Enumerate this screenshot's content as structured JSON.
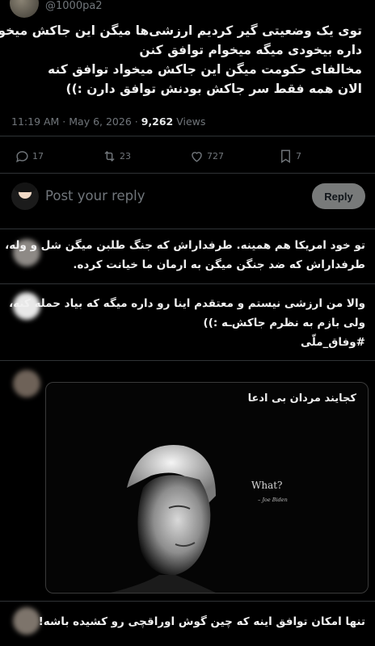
{
  "header": {
    "handle": "@1000pa2"
  },
  "tweet": {
    "lines": [
      "توی یک وضعیتی گیر کردیم ارزشی‌ها میگن این جاکش میخواد حمله کنه",
      "داره بیخودی میگه میخوام توافق کنن",
      "مخالفای حکومت میگن این جاکش میخواد توافق کنه",
      "الان همه فقط سر جاکش بودنش توافق دارن :))"
    ],
    "time": "11:19 AM · May 6, 2026 · ",
    "views_count": "9,262",
    "views_label": " Views"
  },
  "actions": {
    "replies": "17",
    "retweets": "23",
    "likes": "727",
    "bookmarks": "7"
  },
  "composer": {
    "placeholder": "Post your reply",
    "button": "Reply"
  },
  "replies": [
    {
      "lines": [
        "تو خود امریکا هم همینه. طرفداراش که جنگ طلبن میگن شل و وله،",
        "طرفداراش که ضد جنگن میگن به ارمان ما خیانت کرده."
      ]
    },
    {
      "lines": [
        "والا من ارزشی نیستم و معتقدم اینا رو داره میگه که بیاد حمله کنه،",
        "ولی بازم به نظرم جاکش‌ـه :))",
        "#وفاق_ملّی"
      ]
    },
    {
      "media": {
        "caption": "کجایند مردان بی ادعا",
        "quote": "What?",
        "credit": "– Joe Biden"
      }
    },
    {
      "lines": [
        "تنها امکان توافق اینه که چین گوش اوراقچی رو کشیده باشه!"
      ]
    }
  ],
  "icons": {
    "reply": "speech-bubble-icon",
    "retweet": "retweet-icon",
    "like": "heart-icon",
    "bookmark": "bookmark-icon"
  }
}
